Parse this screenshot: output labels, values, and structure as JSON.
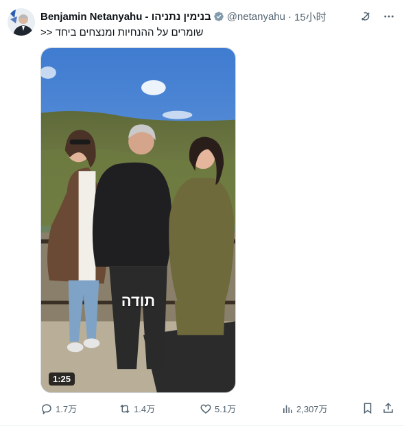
{
  "author": {
    "display_name": "Benjamin Netanyahu - בנימין נתניהו",
    "handle": "@netanyahu",
    "separator": "·",
    "time": "15小时",
    "verified_color": "#829aab"
  },
  "tweet": {
    "text": "שומרים על ההנחיות ומנצחים ביחד <<"
  },
  "media": {
    "overlay_caption": "תודה",
    "duration": "1:25"
  },
  "actions": {
    "reply_count": "1.7万",
    "retweet_count": "1.4万",
    "like_count": "5.1万",
    "views_count": "2,307万"
  },
  "icons": {
    "grok": "grok-icon",
    "more": "more-icon",
    "reply": "reply-icon",
    "retweet": "retweet-icon",
    "like": "like-icon",
    "views": "views-icon",
    "bookmark": "bookmark-icon",
    "share": "share-icon"
  },
  "colors": {
    "text": "#0f1419",
    "secondary": "#536471"
  }
}
